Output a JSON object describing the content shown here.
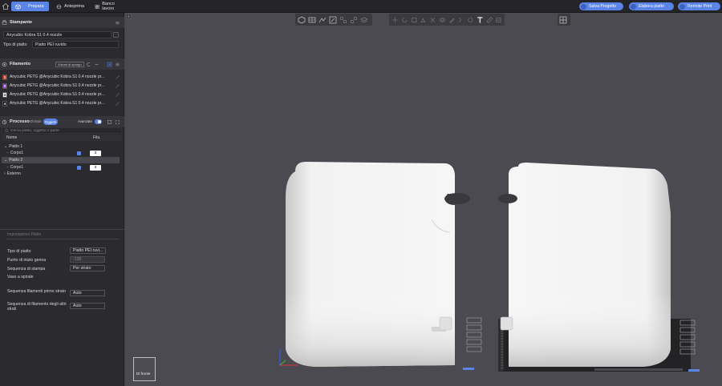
{
  "topbar": {
    "tabs": [
      {
        "label": "Prepara",
        "icon": "cube-icon",
        "active": true
      },
      {
        "label": "Anteprima",
        "icon": "preview-icon",
        "active": false
      },
      {
        "label": "Banco lavoro",
        "icon": "grid-icon",
        "active": false
      }
    ],
    "buttons": [
      {
        "label": "Salva Progetto"
      },
      {
        "label": "Elabora piatto"
      },
      {
        "label": "Remote Print"
      }
    ]
  },
  "printer": {
    "header": "Stampante",
    "printer_name": "Anycubic Kobra S1 0.4 nozzle",
    "plate_label": "Tipo di piatto",
    "plate_value": "Piatto PEI ruvido"
  },
  "filament": {
    "header": "Filamento",
    "purge_button": "Volumi di spurgo",
    "items": [
      {
        "num": "1",
        "color": "#d9342b",
        "name": "Anycubic PETG @Anycubic Kobra S1 0.4 nozzle pr..."
      },
      {
        "num": "2",
        "color": "#8b3fd9",
        "name": "Anycubic PETG @Anycubic Kobra S1 0.4 nozzle pr..."
      },
      {
        "num": "3",
        "color": "#ffffff",
        "name": "Anycubic PETG @Anycubic Kobra S1 0.4 nozzle pr..."
      },
      {
        "num": "4",
        "color": "#111111",
        "name": "Anycubic PETG @Anycubic Kobra S1 0.4 nozzle pr..."
      }
    ]
  },
  "process": {
    "header": "Processo",
    "toggle_global": "Globale",
    "toggle_objects": "Oggetti",
    "advanced_label": "Avanzate",
    "search_placeholder": "Cerca piatto, oggetto o parte",
    "col_name": "Nome",
    "col_fila": "Fila.",
    "tree": [
      {
        "label": "Piatto 1",
        "kind": "plate"
      },
      {
        "label": "Corpo1",
        "kind": "object",
        "fila": "3"
      },
      {
        "label": "Piatto 2",
        "kind": "plate",
        "selected": true
      },
      {
        "label": "Corpo1",
        "kind": "object",
        "fila": "3"
      },
      {
        "label": "Esterno",
        "kind": "plate"
      }
    ]
  },
  "plate_settings": {
    "tab_label": "Impostazioni Piatto",
    "rows": [
      {
        "label": "Tipo di piatto",
        "value": "Piatto PEI ruvi..."
      },
      {
        "label": "Punto di inizio genna",
        "value": "-135"
      },
      {
        "label": "Sequenza di stampa",
        "value": "Per strato"
      },
      {
        "label": "Vaso a spirale",
        "value": ""
      },
      {
        "label": "Sequenza filamenti primo strato",
        "value": "Auto"
      },
      {
        "label": "Sequenza di filamento degli altri strati",
        "value": "Auto"
      }
    ]
  },
  "viewport": {
    "view_label": "Di fronte"
  },
  "colors": {
    "accent": "#5a84e6",
    "sidebar_bg": "#2b2b2f",
    "viewport_bg": "#4a4a50"
  }
}
